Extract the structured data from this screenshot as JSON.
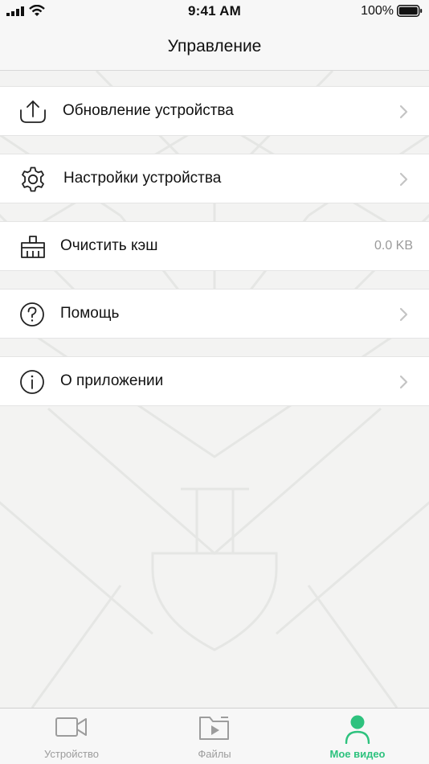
{
  "status_bar": {
    "time": "9:41 AM",
    "battery": "100%",
    "icons": [
      "signal-icon",
      "wifi-icon",
      "battery-icon"
    ]
  },
  "nav": {
    "title": "Управление"
  },
  "menu": {
    "items": [
      {
        "label": "Обновление устройства",
        "icon": "upload-icon",
        "chevron": true
      },
      {
        "label": "Настройки устройства",
        "icon": "gear-icon",
        "chevron": true
      },
      {
        "label": "Очистить кэш",
        "icon": "broom-icon",
        "value": "0.0 KB"
      },
      {
        "label": "Помощь",
        "icon": "help-icon",
        "chevron": true
      },
      {
        "label": "О приложении",
        "icon": "info-icon",
        "chevron": true
      }
    ]
  },
  "tabs": [
    {
      "label": "Устройство",
      "icon": "video-camera-icon",
      "active": false
    },
    {
      "label": "Файлы",
      "icon": "video-folder-icon",
      "active": false
    },
    {
      "label": "Мое видео",
      "icon": "user-icon",
      "active": true
    }
  ],
  "colors": {
    "accent": "#2ec27e",
    "background": "#f3f3f2",
    "row_background": "#ffffff",
    "inactive_tab": "#9c9c9c"
  }
}
